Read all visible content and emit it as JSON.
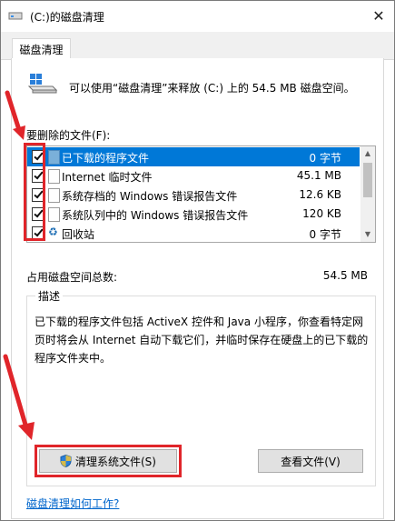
{
  "window": {
    "title": "(C:)的磁盘清理",
    "close_glyph": "✕"
  },
  "tab": {
    "label": "磁盘清理"
  },
  "summary": "可以使用“磁盘清理”来释放  (C:) 上的 54.5 MB 磁盘空间。",
  "files": {
    "label": "要删除的文件(F):",
    "items": [
      {
        "name": "已下载的程序文件",
        "size": "0 字节",
        "checked": true,
        "selected": true
      },
      {
        "name": "Internet 临时文件",
        "size": "45.1 MB",
        "checked": true,
        "selected": false
      },
      {
        "name": "系统存档的 Windows 错误报告文件",
        "size": "12.6 KB",
        "checked": true,
        "selected": false
      },
      {
        "name": "系统队列中的 Windows 错误报告文件",
        "size": "120 KB",
        "checked": true,
        "selected": false
      },
      {
        "name": "回收站",
        "size": "0 字节",
        "checked": true,
        "selected": false
      }
    ]
  },
  "total": {
    "label": "占用磁盘空间总数:",
    "value": "54.5 MB"
  },
  "description": {
    "title": "描述",
    "text": "已下载的程序文件包括 ActiveX 控件和 Java 小程序，你查看特定网页时将会从 Internet 自动下载它们，并临时保存在硬盘上的已下载的程序文件夹中。"
  },
  "buttons": {
    "clean_system": "清理系统文件(S)",
    "view_files": "查看文件(V)"
  },
  "help_link": "磁盘清理如何工作?",
  "colors": {
    "selection": "#0078d7",
    "highlight_red": "#e0252a",
    "link": "#0066cc"
  }
}
